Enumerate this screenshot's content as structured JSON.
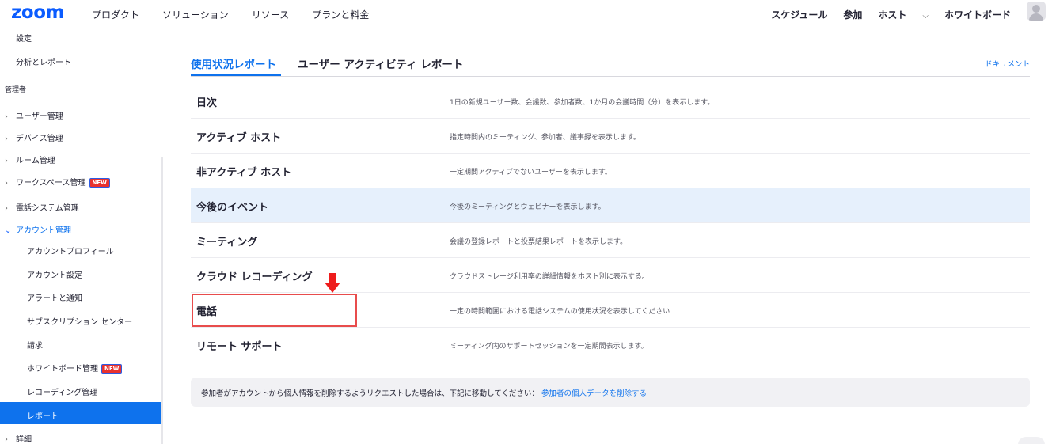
{
  "header": {
    "logo": "zoom",
    "nav": [
      "プロダクト",
      "ソリューション",
      "リソース",
      "プランと料金"
    ],
    "right": {
      "schedule": "スケジュール",
      "join": "参加",
      "host": "ホスト",
      "whiteboard": "ホワイトボード"
    }
  },
  "sidebar": {
    "top_items": [
      "設定",
      "分析とレポート"
    ],
    "section_admin": "管理者",
    "admin_items": [
      "ユーザー管理",
      "デバイス管理",
      "ルーム管理",
      "ワークスペース管理",
      "電話システム管理",
      "アカウント管理"
    ],
    "account_items": [
      "アカウントプロフィール",
      "アカウント設定",
      "アラートと通知",
      "サブスクリプション センター",
      "請求",
      "ホワイトボード管理",
      "レコーディング管理",
      "レポート"
    ],
    "more": "詳細",
    "badge": "NEW",
    "colors": {
      "active_bg": "#0e72ed",
      "badge_bg": "#e8322f"
    }
  },
  "main": {
    "tabs": [
      "使用状況レポート",
      "ユーザー アクティビティ レポート"
    ],
    "doc_link": "ドキュメント",
    "reports": [
      {
        "name": "日次",
        "desc": "1日の新規ユーザー数、会議数、参加者数、1か月の会議時間（分）を表示します。"
      },
      {
        "name": "アクティブ ホスト",
        "desc": "指定時間内のミーティング、参加者、議事録を表示します。"
      },
      {
        "name": "非アクティブ ホスト",
        "desc": "一定期間アクティブでないユーザーを表示します。"
      },
      {
        "name": "今後のイベント",
        "desc": "今後のミーティングとウェビナーを表示します。"
      },
      {
        "name": "ミーティング",
        "desc": "会議の登録レポートと投票結果レポートを表示します。"
      },
      {
        "name": "クラウド レコーディング",
        "desc": "クラウドストレージ利用率の詳細情報をホスト別に表示する。"
      },
      {
        "name": "電話",
        "desc": "一定の時間範囲における電話システムの使用状況を表示してください"
      },
      {
        "name": "リモート サポート",
        "desc": "ミーティング内のサポートセッションを一定期間表示します。"
      }
    ],
    "notice_text": "参加者がアカウントから個人情報を削除するようリクエストした場合は、下記に移動してください：",
    "notice_link": "参加者の個人データを削除する",
    "colors": {
      "accent": "#0e72ed",
      "highlight_row": "#e6f0fc",
      "annotation": "#ee1c1c"
    }
  }
}
